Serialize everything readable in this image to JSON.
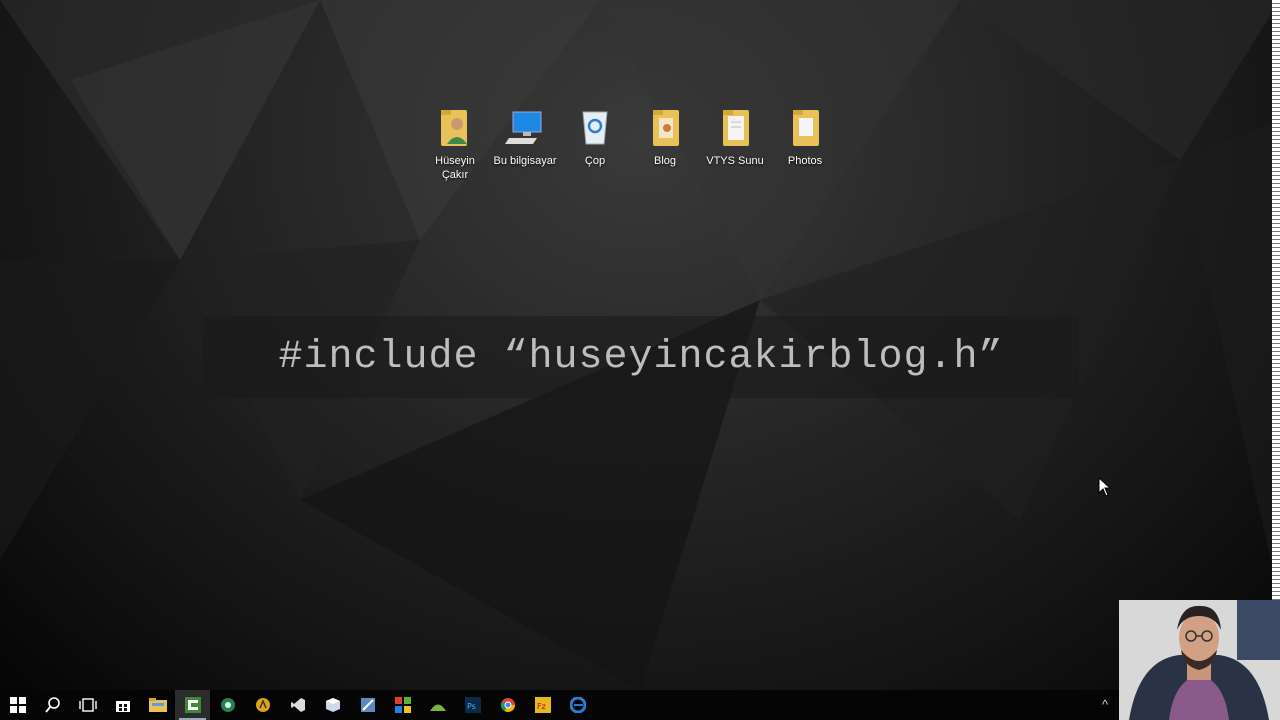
{
  "desktop": {
    "icons": [
      {
        "label": "Hüseyin Çakır",
        "icon": "user-folder-icon"
      },
      {
        "label": "Bu bilgisayar",
        "icon": "computer-icon"
      },
      {
        "label": "Çop",
        "icon": "recycle-bin-icon"
      },
      {
        "label": "Blog",
        "icon": "folder-icon"
      },
      {
        "label": "VTYS Sunu",
        "icon": "folder-icon"
      },
      {
        "label": "Photos",
        "icon": "folder-icon"
      }
    ]
  },
  "banner": {
    "text": "#include “huseyincakirblog.h”"
  },
  "taskbar": {
    "items": [
      "start-icon",
      "search-icon",
      "task-view-icon",
      "store-icon",
      "file-explorer-icon",
      "camtasia-icon",
      "green-app-icon",
      "yellow-app-icon",
      "visual-studio-icon",
      "cube-app-icon",
      "sql-app-icon",
      "office-tiles-icon",
      "android-studio-icon",
      "photoshop-icon",
      "chrome-icon",
      "filezilla-icon",
      "edge-icon"
    ],
    "active_item": "camtasia-icon"
  },
  "colors": {
    "folder": "#e8c15a",
    "taskbar": "#050505",
    "banner_text": "#bdbdbd"
  }
}
